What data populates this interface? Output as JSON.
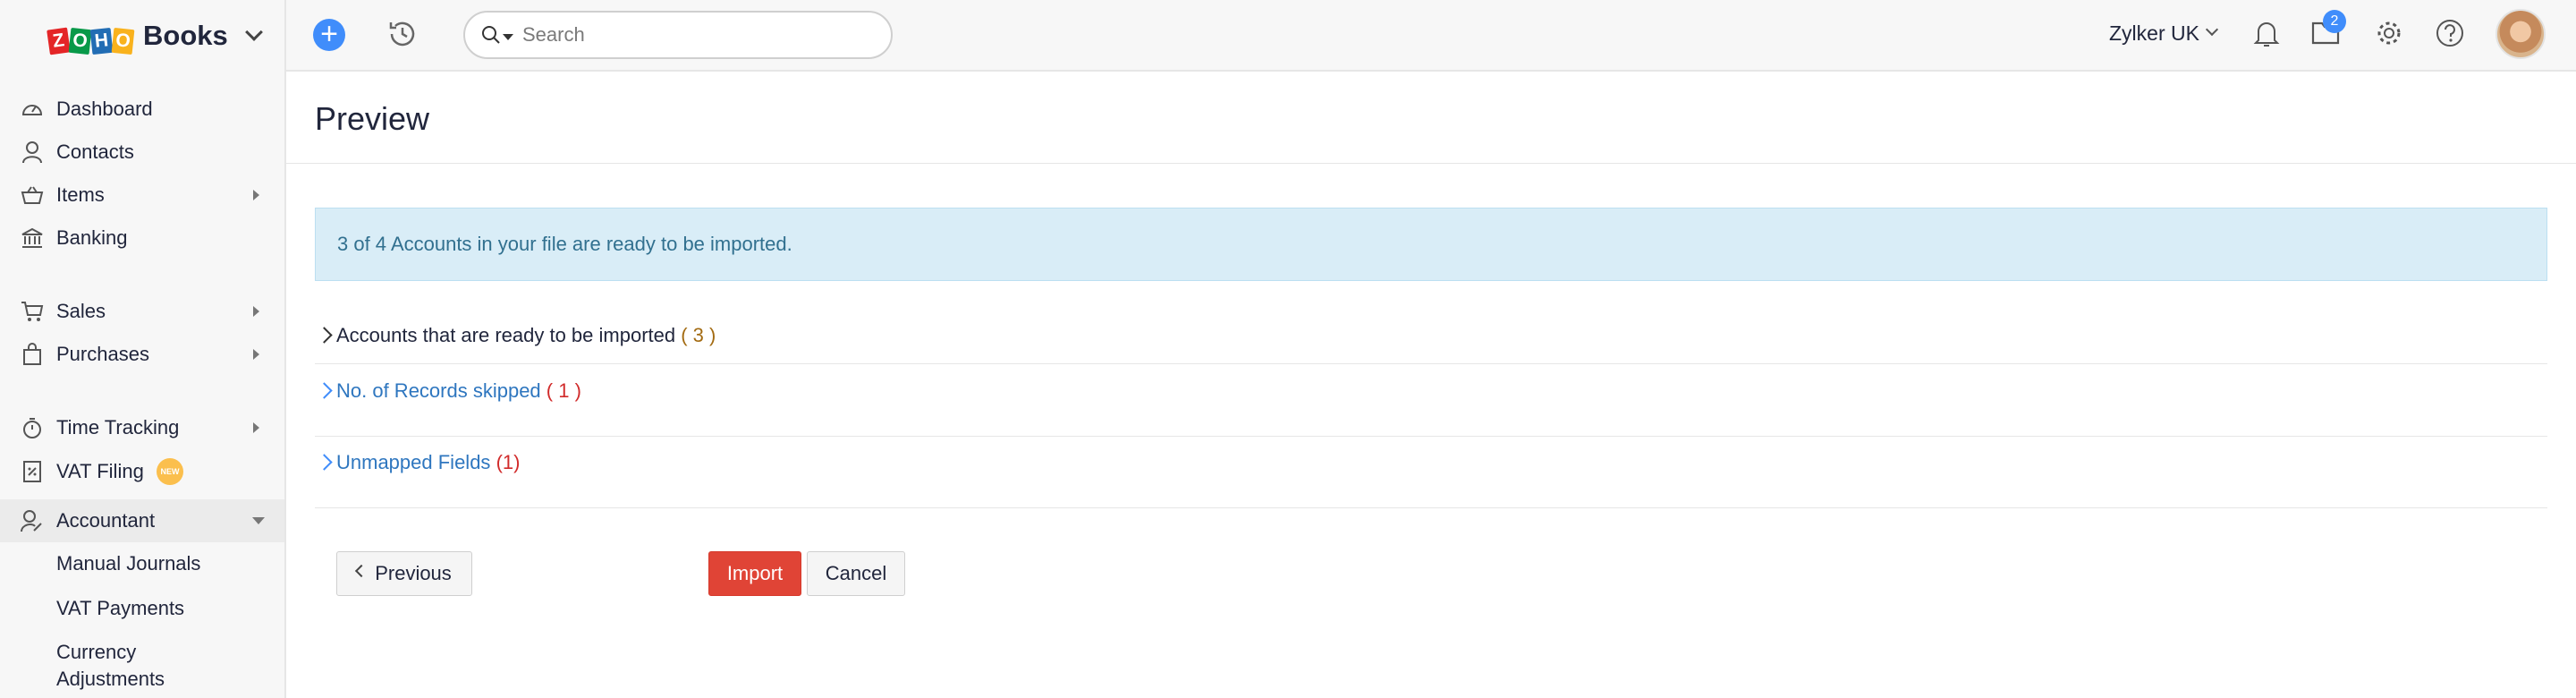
{
  "brand": {
    "logo_letters": [
      "Z",
      "O",
      "H",
      "O"
    ],
    "name": "Books"
  },
  "sidebar": {
    "items": [
      {
        "label": "Dashboard",
        "icon": "dashboard-icon"
      },
      {
        "label": "Contacts",
        "icon": "person-icon"
      },
      {
        "label": "Items",
        "icon": "basket-icon",
        "has_submenu": true
      },
      {
        "label": "Banking",
        "icon": "bank-icon"
      },
      {
        "label": "Sales",
        "icon": "cart-icon",
        "has_submenu": true
      },
      {
        "label": "Purchases",
        "icon": "bag-icon",
        "has_submenu": true
      },
      {
        "label": "Time Tracking",
        "icon": "stopwatch-icon",
        "has_submenu": true
      },
      {
        "label": "VAT Filing",
        "icon": "vat-icon",
        "badge": "NEW"
      },
      {
        "label": "Accountant",
        "icon": "accountant-icon",
        "expanded": true
      }
    ],
    "subitems": [
      {
        "label": "Manual Journals"
      },
      {
        "label": "VAT Payments"
      },
      {
        "label": "Currency"
      },
      {
        "label": "Adjustments"
      }
    ]
  },
  "header": {
    "search_placeholder": "Search",
    "organization": "Zylker UK",
    "notification_count": "2"
  },
  "main": {
    "title": "Preview",
    "banner": "3 of 4 Accounts in your file are ready to be imported.",
    "sections": [
      {
        "label": "Accounts that are ready to be imported",
        "count": "( 3 )"
      },
      {
        "label": "No. of Records skipped",
        "count": "( 1 )"
      },
      {
        "label": "Unmapped Fields",
        "count": "(1)"
      }
    ],
    "buttons": {
      "previous": "Previous",
      "import": "Import",
      "cancel": "Cancel"
    }
  },
  "colors": {
    "accent": "#408dfb",
    "import_button": "#e04436",
    "banner_bg": "#d9edf7",
    "banner_text": "#31708f"
  }
}
